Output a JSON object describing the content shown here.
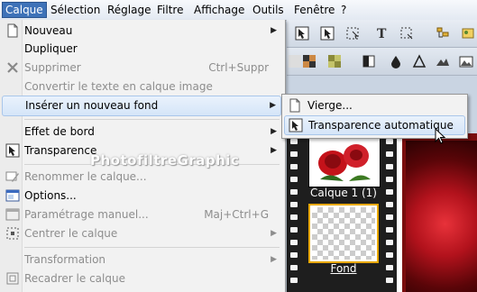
{
  "menubar": {
    "items": [
      "Calque",
      "Sélection",
      "Réglage",
      "Filtre",
      "Affichage",
      "Outils",
      "Fenêtre",
      "?"
    ]
  },
  "menu": {
    "nouveau": "Nouveau",
    "dupliquer": "Dupliquer",
    "supprimer": "Supprimer",
    "supprimer_sc": "Ctrl+Suppr",
    "convertir": "Convertir le texte en calque image",
    "inserer_fond": "Insérer un nouveau fond",
    "effet_bord": "Effet de bord",
    "transparence": "Transparence",
    "renommer": "Renommer le calque...",
    "options": "Options...",
    "parametrage": "Paramétrage manuel...",
    "parametrage_sc": "Maj+Ctrl+G",
    "centrer": "Centrer le calque",
    "transformation": "Transformation",
    "recadrer": "Recadrer le calque"
  },
  "submenu": {
    "vierge": "Vierge...",
    "transparence_auto": "Transparence automatique"
  },
  "watermark": "PhotofiltreGraphic",
  "layers": {
    "layer1_label": "Calque 1 (1)",
    "fond_label": "Fond"
  },
  "colors": {
    "accent": "#3e72b8",
    "menu_bg": "#f2f2f2",
    "highlight": "#d5e5f8"
  }
}
